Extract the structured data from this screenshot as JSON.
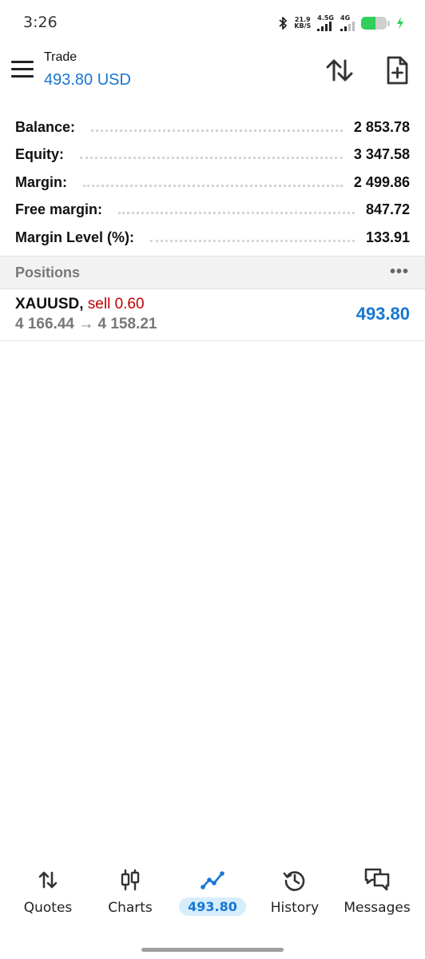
{
  "status_bar": {
    "time": "3:26",
    "net_speed_value": "21.9",
    "net_speed_unit": "KB/S",
    "signal1_label": "4.5G",
    "signal2_label": "4G",
    "battery_level": 0.55,
    "battery_color": "#2fcf5a"
  },
  "header": {
    "title": "Trade",
    "balance": "493.80 USD",
    "menu_icon": "hamburger-menu-icon",
    "sort_icon": "sort-arrows-icon",
    "new_order_icon": "new-document-plus-icon"
  },
  "summary": [
    {
      "label": "Balance:",
      "value": "2 853.78"
    },
    {
      "label": "Equity:",
      "value": "3 347.58"
    },
    {
      "label": "Margin:",
      "value": "2 499.86"
    },
    {
      "label": "Free margin:",
      "value": "847.72"
    },
    {
      "label": "Margin Level (%):",
      "value": "133.91"
    }
  ],
  "positions": {
    "title": "Positions",
    "more": "•••",
    "items": [
      {
        "symbol": "XAUUSD,",
        "type": "sell 0.60",
        "prices": "4 166.44 → 4 158.21",
        "profit": "493.80"
      }
    ]
  },
  "bottom_nav": {
    "items": [
      {
        "label": "Quotes",
        "icon": "quotes-arrows-icon"
      },
      {
        "label": "Charts",
        "icon": "candlestick-chart-icon"
      },
      {
        "label": "493.80",
        "icon": "trade-line-icon",
        "active": true
      },
      {
        "label": "History",
        "icon": "history-clock-icon"
      },
      {
        "label": "Messages",
        "icon": "messages-chat-icon"
      }
    ]
  },
  "colors": {
    "accent": "#1976d2",
    "sell": "#c00000",
    "active_pill_bg": "#d6edfb"
  }
}
